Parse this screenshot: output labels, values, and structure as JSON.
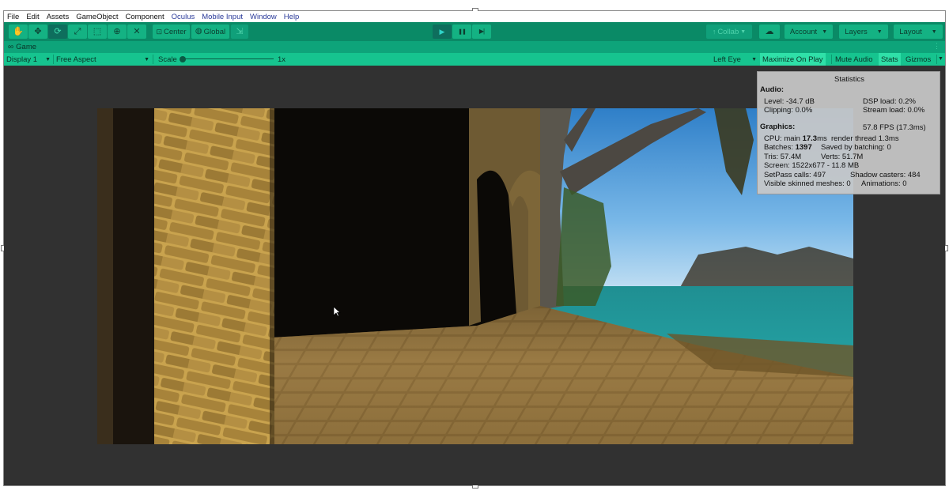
{
  "menu": [
    "File",
    "Edit",
    "Assets",
    "GameObject",
    "Component",
    "Oculus",
    "Mobile Input",
    "Window",
    "Help"
  ],
  "toolbar": {
    "tools": [
      {
        "name": "hand-tool",
        "icon": "✋"
      },
      {
        "name": "move-tool",
        "icon": "✥"
      },
      {
        "name": "rotate-tool",
        "icon": "⟳"
      },
      {
        "name": "scale-tool",
        "icon": "⤢"
      },
      {
        "name": "rect-tool",
        "icon": "⬚"
      },
      {
        "name": "transform-tool",
        "icon": "⊕"
      },
      {
        "name": "custom-tool",
        "icon": "✕"
      }
    ],
    "pivot_label": "Center",
    "space_label": "Global",
    "snap_icon": "⇲",
    "play_icon": "▶",
    "pause_icon": "❚❚",
    "step_icon": "▶|",
    "collab_label": "Collab",
    "cloud_icon": "☁",
    "account_label": "Account",
    "layers_label": "Layers",
    "layout_label": "Layout"
  },
  "tab": {
    "icon": "∞",
    "label": "Game"
  },
  "gamebar": {
    "display": "Display 1",
    "aspect": "Free Aspect",
    "scale_label": "Scale",
    "scale_value": "1x",
    "eye": "Left Eye",
    "maximize": "Maximize On Play",
    "mute": "Mute Audio",
    "stats": "Stats",
    "gizmos": "Gizmos"
  },
  "stats": {
    "title": "Statistics",
    "audio_header": "Audio:",
    "level": "Level: -34.7 dB",
    "clipping": "Clipping: 0.0%",
    "dsp": "DSP load: 0.2%",
    "stream": "Stream load: 0.0%",
    "graphics_header": "Graphics:",
    "fps": "57.8 FPS (17.3ms)",
    "cpu_prefix": "CPU: main ",
    "cpu_main": "17.3",
    "cpu_suffix": "ms  render thread 1.3ms",
    "batches_prefix": "Batches: ",
    "batches": "1397",
    "saved": "Saved by batching: 0",
    "tris": "Tris: 57.4M",
    "verts": "Verts: 51.7M",
    "screen": "Screen: 1522x677 - 11.8 MB",
    "setpass": "SetPass calls: 497",
    "shadow": "Shadow casters: 484",
    "skinned": "Visible skinned meshes: 0",
    "animations": "Animations: 0"
  }
}
